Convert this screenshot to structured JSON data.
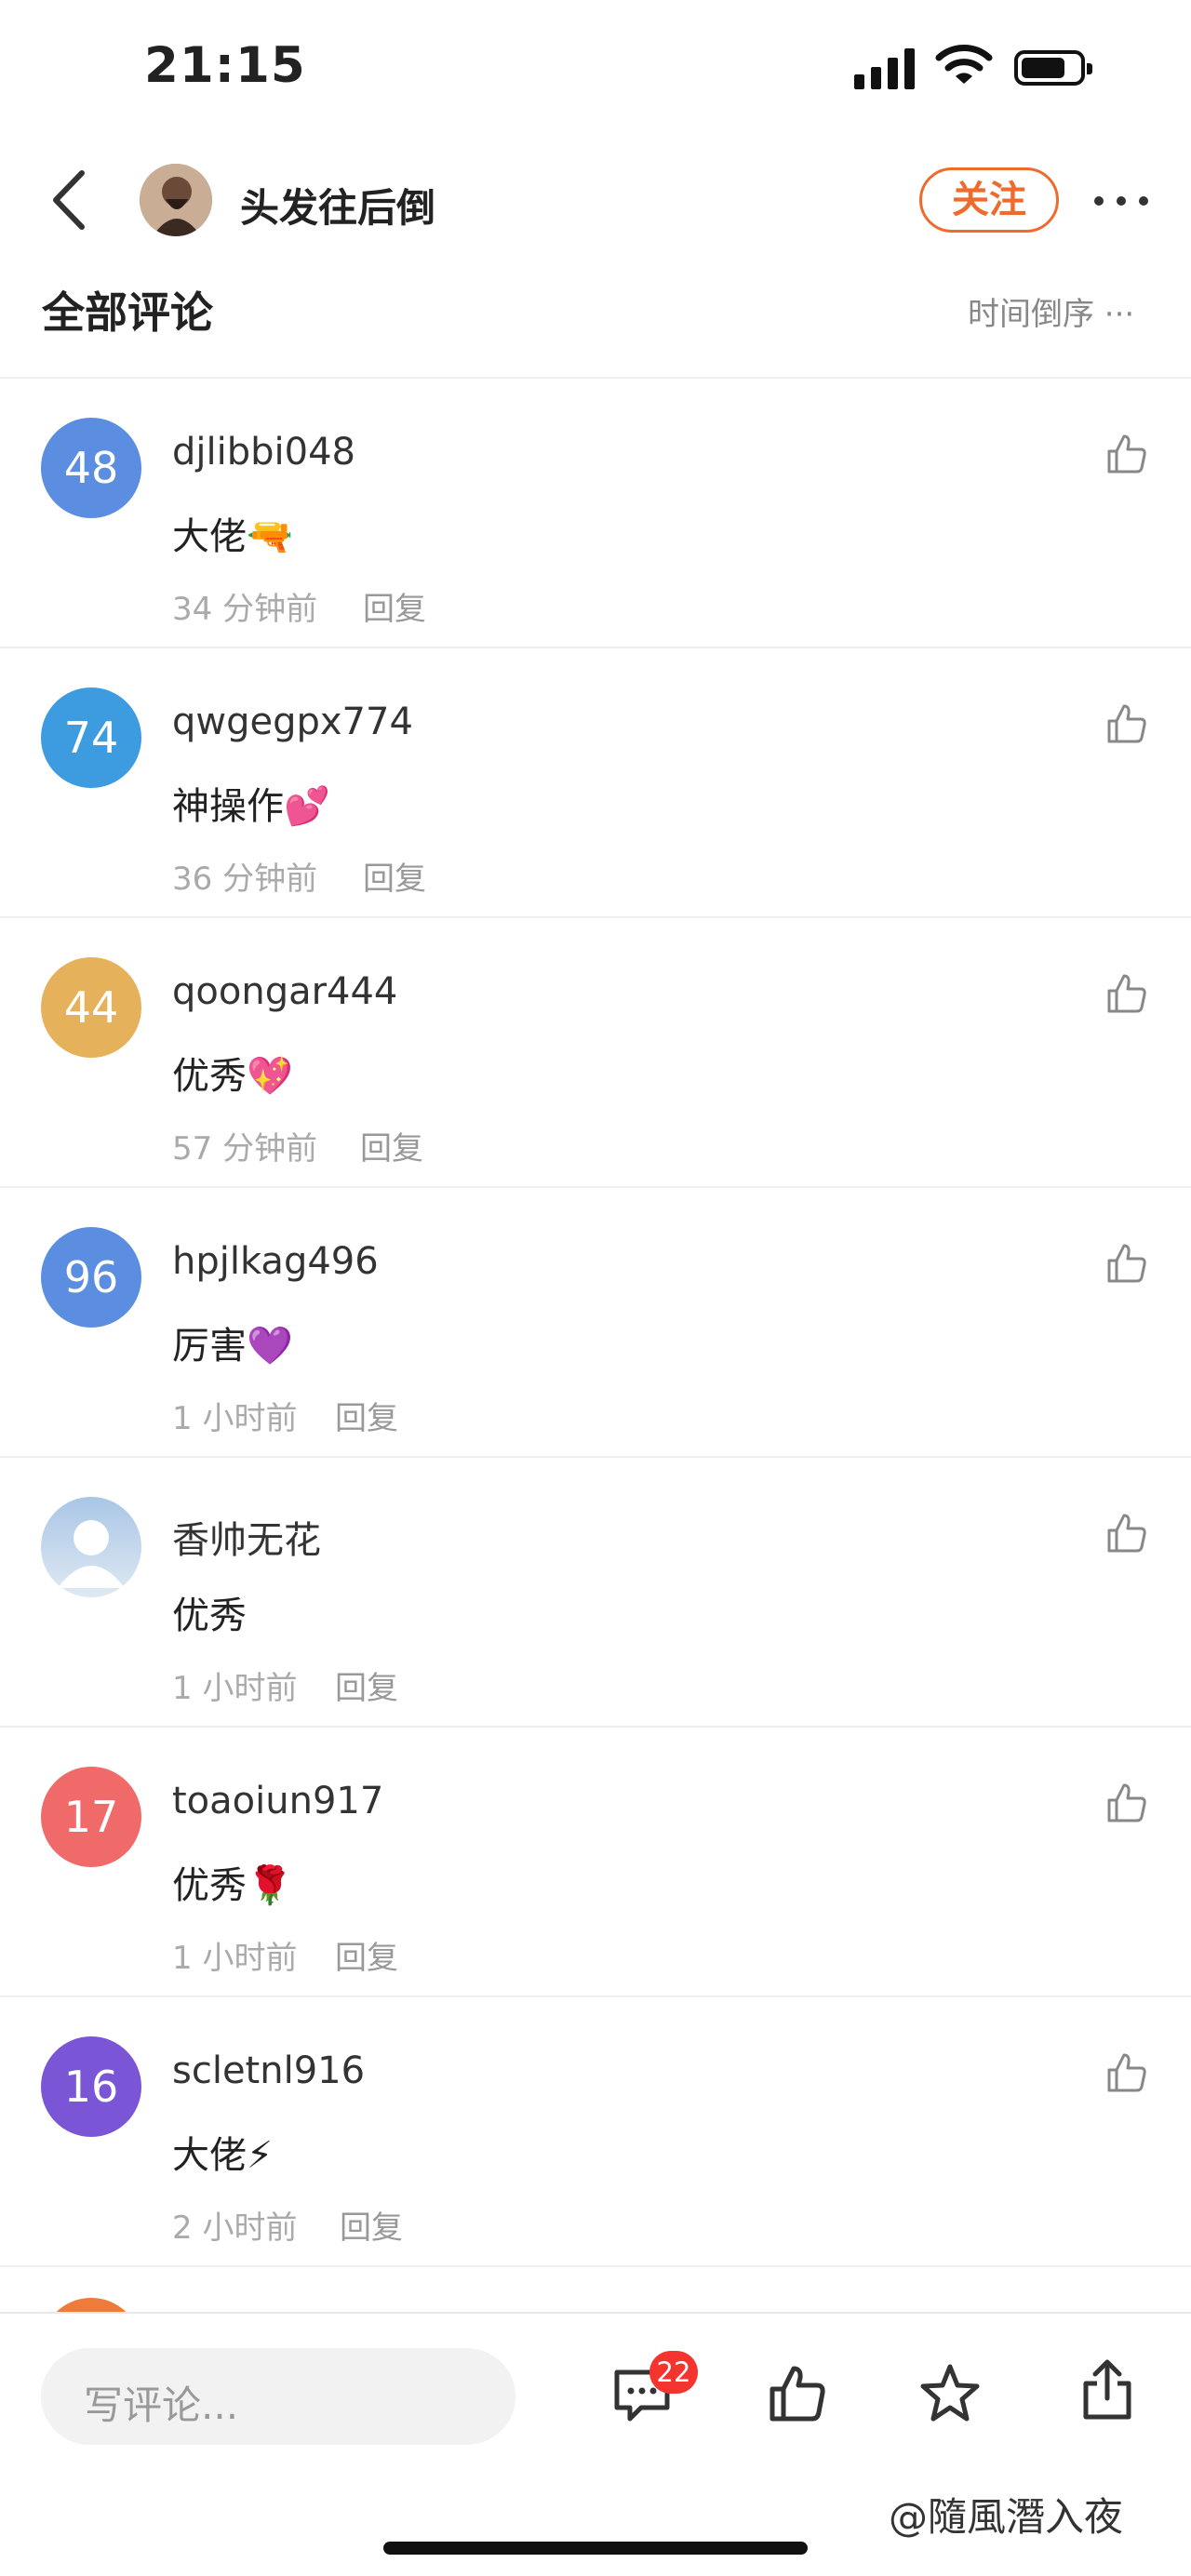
{
  "status_bar": {
    "time": "21:15"
  },
  "header": {
    "username": "头发往后倒",
    "follow_label": "关注"
  },
  "section": {
    "title": "全部评论",
    "sort_label": "时间倒序 ···"
  },
  "comments": [
    {
      "avatar_text": "48",
      "avatar_color": "#5b8de0",
      "name": "djlibbi048",
      "text": "大佬",
      "emoji": "🔫",
      "time": "34 分钟前",
      "reply": "回复"
    },
    {
      "avatar_text": "74",
      "avatar_color": "#3d9be0",
      "name": "qwgegpx774",
      "text": "神操作",
      "emoji": "💕",
      "time": "36 分钟前",
      "reply": "回复"
    },
    {
      "avatar_text": "44",
      "avatar_color": "#e5b15b",
      "name": "qoongar444",
      "text": "优秀",
      "emoji": "💖",
      "time": "57 分钟前",
      "reply": "回复"
    },
    {
      "avatar_text": "96",
      "avatar_color": "#5b8de0",
      "name": "hpjlkag496",
      "text": "厉害",
      "emoji": "💜",
      "time": "1 小时前",
      "reply": "回复"
    },
    {
      "avatar_text": "",
      "avatar_color": "#b9d2ea",
      "name": "香帅无花",
      "text": "优秀",
      "emoji": "",
      "time": "1 小时前",
      "reply": "回复"
    },
    {
      "avatar_text": "17",
      "avatar_color": "#f06a6a",
      "name": "toaoiun917",
      "text": "优秀",
      "emoji": "🌹",
      "time": "1 小时前",
      "reply": "回复"
    },
    {
      "avatar_text": "16",
      "avatar_color": "#7a55d6",
      "name": "scletnl916",
      "text": "大佬",
      "emoji": "⚡",
      "time": "2 小时前",
      "reply": "回复"
    }
  ],
  "bottom_bar": {
    "input_placeholder": "写评论...",
    "comment_count": "22"
  },
  "watermark": "@隨風潛入夜",
  "icons": [
    "back-icon",
    "more-icon",
    "like-icon",
    "comment-icon",
    "star-icon",
    "share-icon"
  ]
}
